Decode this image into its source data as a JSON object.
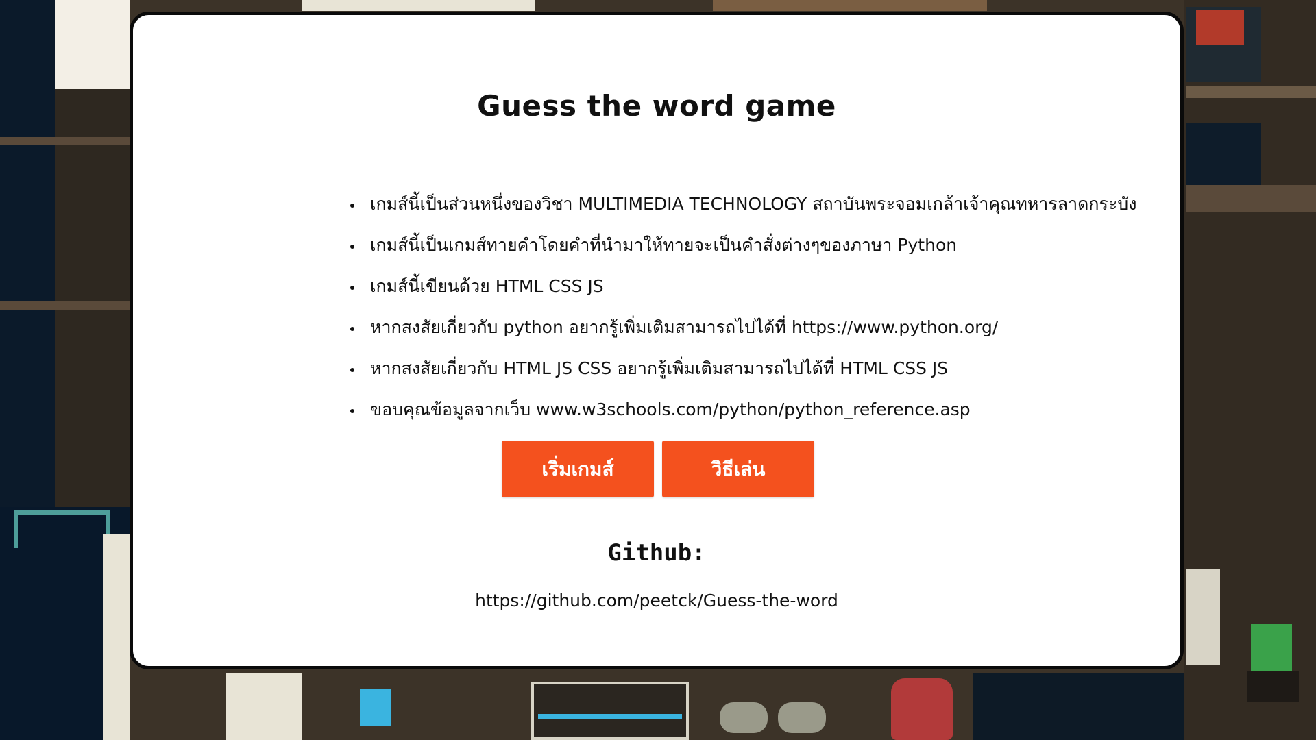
{
  "game": {
    "title": "Guess the word game",
    "info_items": [
      "เกมส์นี้เป็นส่วนหนึ่งของวิชา MULTIMEDIA TECHNOLOGY สถาบันพระจอมเกล้าเจ้าคุณทหารลาดกระบัง",
      "เกมส์นี้เป็นเกมส์ทายคำโดยคำที่นำมาให้ทายจะเป็นคำสั่งต่างๆของภาษา Python",
      "เกมส์นี้เขียนด้วย HTML CSS JS",
      "หากสงสัยเกี่ยวกับ python อยากรู้เพิ่มเติมสามารถไปได้ที่ https://www.python.org/",
      "หากสงสัยเกี่ยวกับ HTML JS CSS อยากรู้เพิ่มเติมสามารถไปได้ที่ HTML CSS JS",
      "ขอบคุณข้อมูลจากเว็บ www.w3schools.com/python/python_reference.asp"
    ],
    "buttons": {
      "start": "เริ่มเกมส์",
      "how_to_play": "วิธีเล่น"
    },
    "github": {
      "label": "Github:",
      "url": "https://github.com/peetck/Guess-the-word"
    }
  },
  "colors": {
    "button": "#f4511e",
    "modal_bg": "#ffffff",
    "modal_border": "#0a0a0a",
    "background": "#3c3328"
  },
  "background": {
    "description_icons": [
      "pixel-art-room-background"
    ]
  }
}
